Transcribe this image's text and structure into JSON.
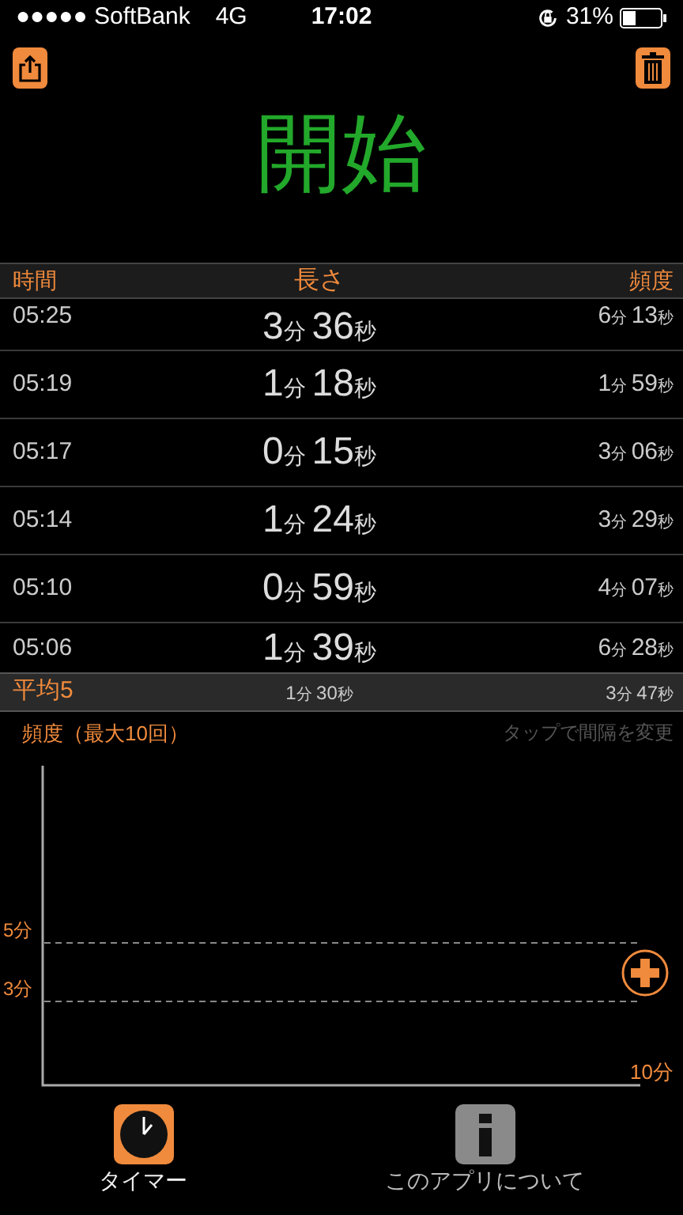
{
  "status_bar": {
    "carrier": "●●●●● SoftBank",
    "network": "4G",
    "time": "17:02",
    "battery": "31%"
  },
  "title": "開始",
  "table": {
    "columns": [
      "時間",
      "長さ",
      "頻度"
    ],
    "rows": [
      {
        "time": "05:25",
        "length": "3分 36秒",
        "interval": "6分 13秒"
      },
      {
        "time": "05:19",
        "length": "1分 18秒",
        "interval": "1分 59秒"
      },
      {
        "time": "05:17",
        "length": "0分 15秒",
        "interval": "3分 06秒"
      },
      {
        "time": "05:14",
        "length": "1分 24秒",
        "interval": "3分 29秒"
      },
      {
        "time": "05:10",
        "length": "0分 59秒",
        "interval": "4分 07秒"
      },
      {
        "time": "05:06",
        "length": "1分 39秒",
        "interval": "6分 28秒"
      }
    ],
    "average": {
      "label": "平均5",
      "length": "1分 30秒",
      "interval": "3分 47秒"
    }
  },
  "chart": {
    "title": "頻度（最大10回）",
    "hint": "タップで間隔を変更",
    "y_labels": [
      "5分",
      "3分"
    ],
    "x_label": "10分"
  },
  "tabs": [
    {
      "label": "タイマー",
      "kind": "timer",
      "selected": true
    },
    {
      "label": "このアプリについて",
      "kind": "info",
      "selected": false
    }
  ]
}
